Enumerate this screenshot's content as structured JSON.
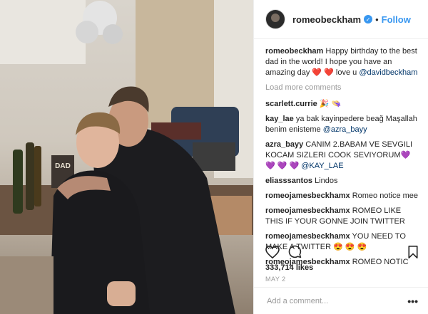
{
  "post": {
    "username": "romeobeckham",
    "follow_label": "Follow",
    "separator": "•",
    "caption_user": "romeobeckham",
    "caption_text": "Happy birthday to the best dad in the world! I hope you have an amazing day ❤️ ❤️  love u ",
    "caption_mention": "@davidbeckham",
    "load_more": "Load more comments",
    "likes": "333,714 likes",
    "date": "MAY 2",
    "add_comment_placeholder": "Add a comment...",
    "more_options": "•••"
  },
  "comments": [
    {
      "user": "scarlett.currie",
      "text": "🎉 👒",
      "mention": ""
    },
    {
      "user": "kay_lae",
      "text": "ya bak kayinpedere beağ Maşallah benim enisteme ",
      "mention": "@azra_bayy"
    },
    {
      "user": "azra_bayy",
      "text": "CANIM 2.BABAM VE SEVGILI KOCAM SIZLERI COOK SEVIYORUM💜 💜 💜 💜 ",
      "mention": "@KAY_LAE"
    },
    {
      "user": "eliasssantos",
      "text": "Lindos",
      "mention": ""
    },
    {
      "user": "romeojamesbeckhamx",
      "text": "Romeo notice mee",
      "mention": ""
    },
    {
      "user": "romeojamesbeckhamx",
      "text": "ROMEO LIKE THIS IF YOUR GONNE JOIN TWITTER",
      "mention": ""
    },
    {
      "user": "romeojamesbeckhamx",
      "text": "YOU NEED TO MAKE A TWITTER 😍 😍 😍",
      "mention": ""
    },
    {
      "user": "romeojamesbeckhamx",
      "text": "ROMEO NOTIC",
      "mention": ""
    }
  ],
  "photo_sign": "DAD",
  "icons": [
    "heart-icon",
    "comment-icon",
    "bookmark-icon",
    "verified-badge-icon"
  ],
  "colors": {
    "accent": "#3897f0",
    "mention": "#003569",
    "muted": "#999999"
  }
}
